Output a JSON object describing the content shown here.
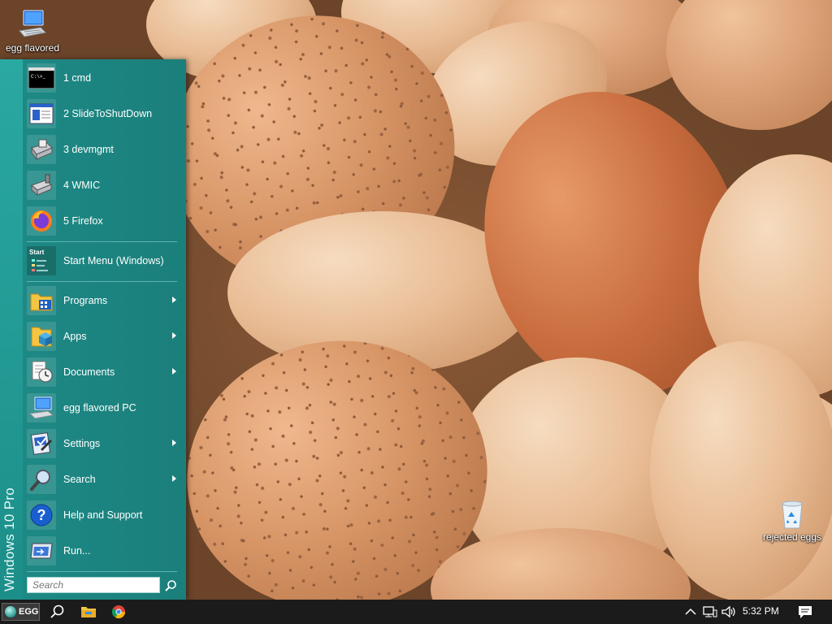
{
  "desktop": {
    "icons": [
      {
        "label": "egg flavored",
        "icon": "computer-icon"
      },
      {
        "label": "rejected eggs",
        "icon": "recycle-bin-icon"
      }
    ]
  },
  "start_menu": {
    "side_title": "Windows 10 Pro",
    "recent": [
      {
        "label": "1 cmd",
        "icon": "cmd-icon"
      },
      {
        "label": "2 SlideToShutDown",
        "icon": "slide-shutdown-icon"
      },
      {
        "label": "3 devmgmt",
        "icon": "device-manager-icon"
      },
      {
        "label": "4 WMIC",
        "icon": "wmic-icon"
      },
      {
        "label": "5 Firefox",
        "icon": "firefox-icon"
      }
    ],
    "pinned": {
      "label": "Start Menu (Windows)",
      "icon": "start-menu-icon",
      "icon_text": "Start"
    },
    "items": [
      {
        "label": "Programs",
        "icon": "programs-icon",
        "submenu": true
      },
      {
        "label": "Apps",
        "icon": "apps-icon",
        "submenu": true
      },
      {
        "label": "Documents",
        "icon": "documents-icon",
        "submenu": true
      },
      {
        "label": "egg flavored PC",
        "icon": "computer-icon",
        "submenu": false
      },
      {
        "label": "Settings",
        "icon": "settings-icon",
        "submenu": true
      },
      {
        "label": "Search",
        "icon": "search-icon",
        "submenu": true
      },
      {
        "label": "Help and Support",
        "icon": "help-icon",
        "submenu": false
      },
      {
        "label": "Run...",
        "icon": "run-icon",
        "submenu": false
      }
    ],
    "search": {
      "placeholder": "Search"
    }
  },
  "taskbar": {
    "start_label": "EGG",
    "pinned_icons": [
      "search-icon",
      "file-explorer-icon",
      "chrome-icon"
    ],
    "tray_icons": [
      "chevron-up-icon",
      "network-icon",
      "volume-icon"
    ],
    "time": "5:32 PM",
    "notification_icon": "action-center-icon"
  },
  "colors": {
    "menu_background": "#1b7f7b",
    "menu_band": "#2aa8a2",
    "taskbar": "#1b1b1b"
  }
}
